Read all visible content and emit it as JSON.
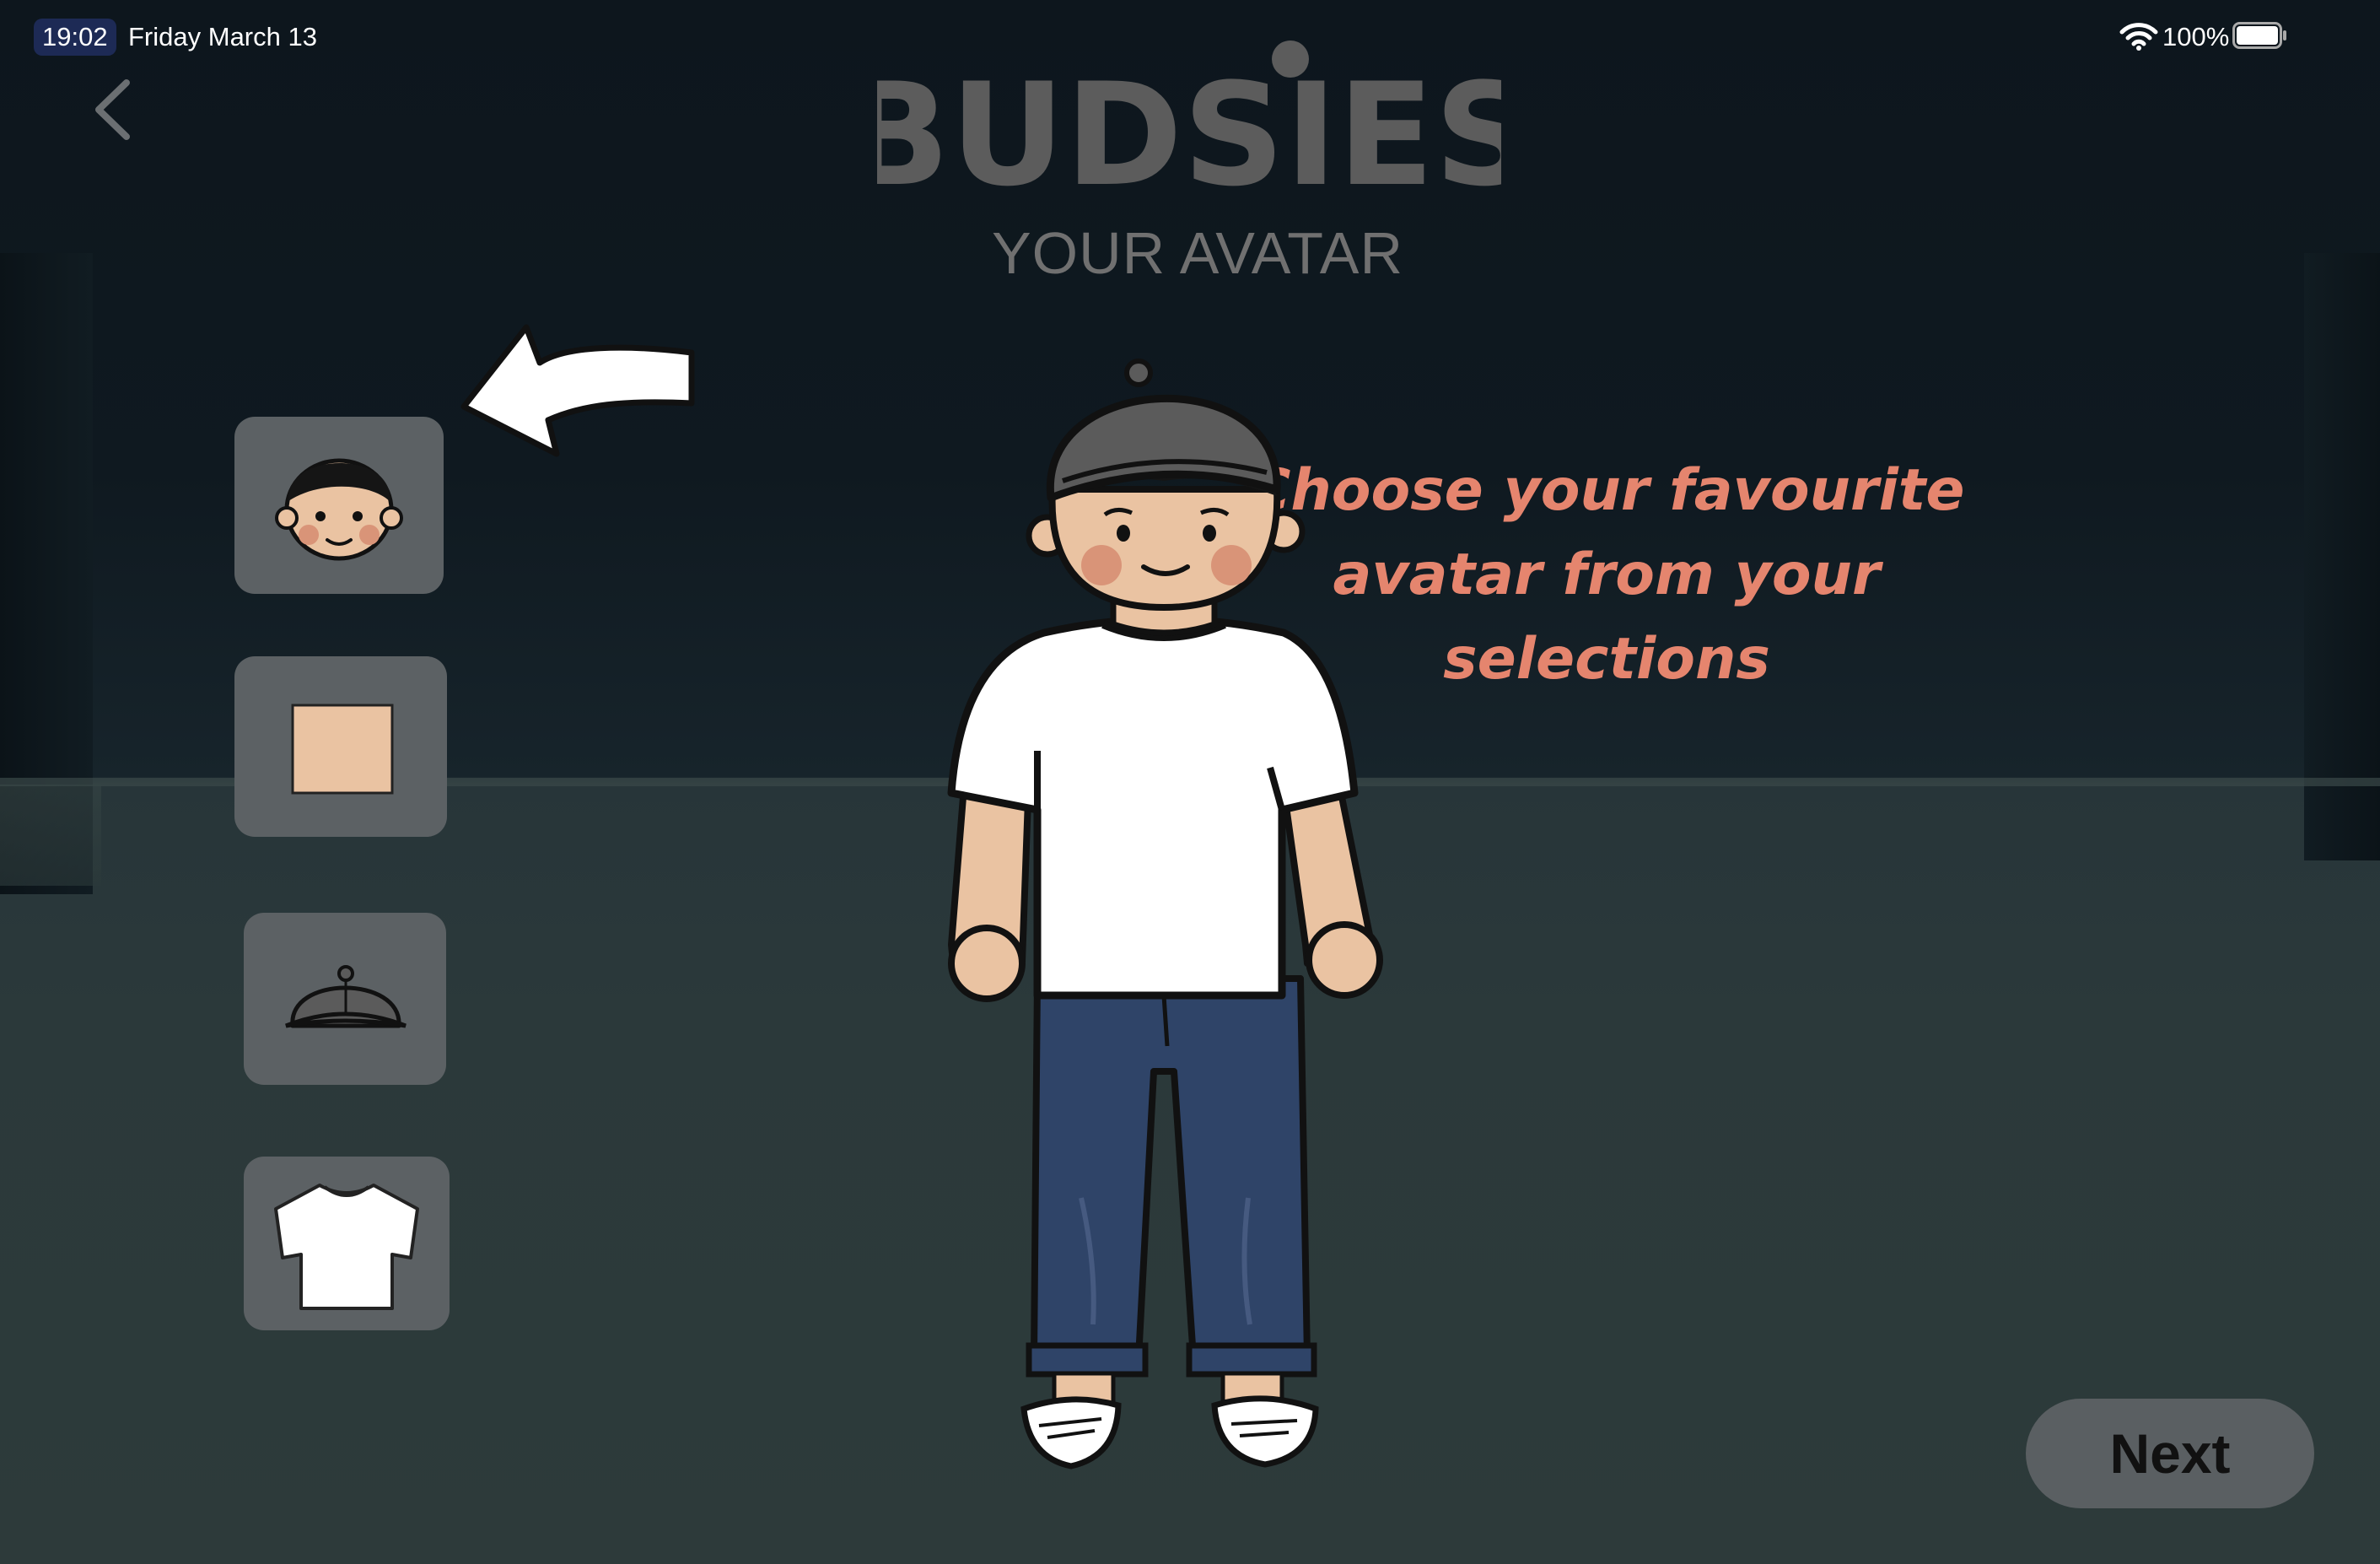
{
  "status_bar": {
    "time": "19:02",
    "date": "Friday March 13",
    "battery": "100%"
  },
  "header": {
    "logo_text": "BUDSIES",
    "title": "YOUR AVATAR"
  },
  "hint": "Choose your favourite avatar from your selections",
  "selectors": [
    {
      "name": "face",
      "icon": "face-icon"
    },
    {
      "name": "skin-tone",
      "icon": "skin-swatch",
      "color": "#eac3a2"
    },
    {
      "name": "hat",
      "icon": "cap-icon"
    },
    {
      "name": "shirt",
      "icon": "tshirt-icon"
    }
  ],
  "next_label": "Next",
  "colors": {
    "accent_text": "#e5856e",
    "skin": "#eac3a2",
    "jeans": "#2f4468",
    "cap": "#5b5b5b",
    "tile": "#5c6164"
  }
}
